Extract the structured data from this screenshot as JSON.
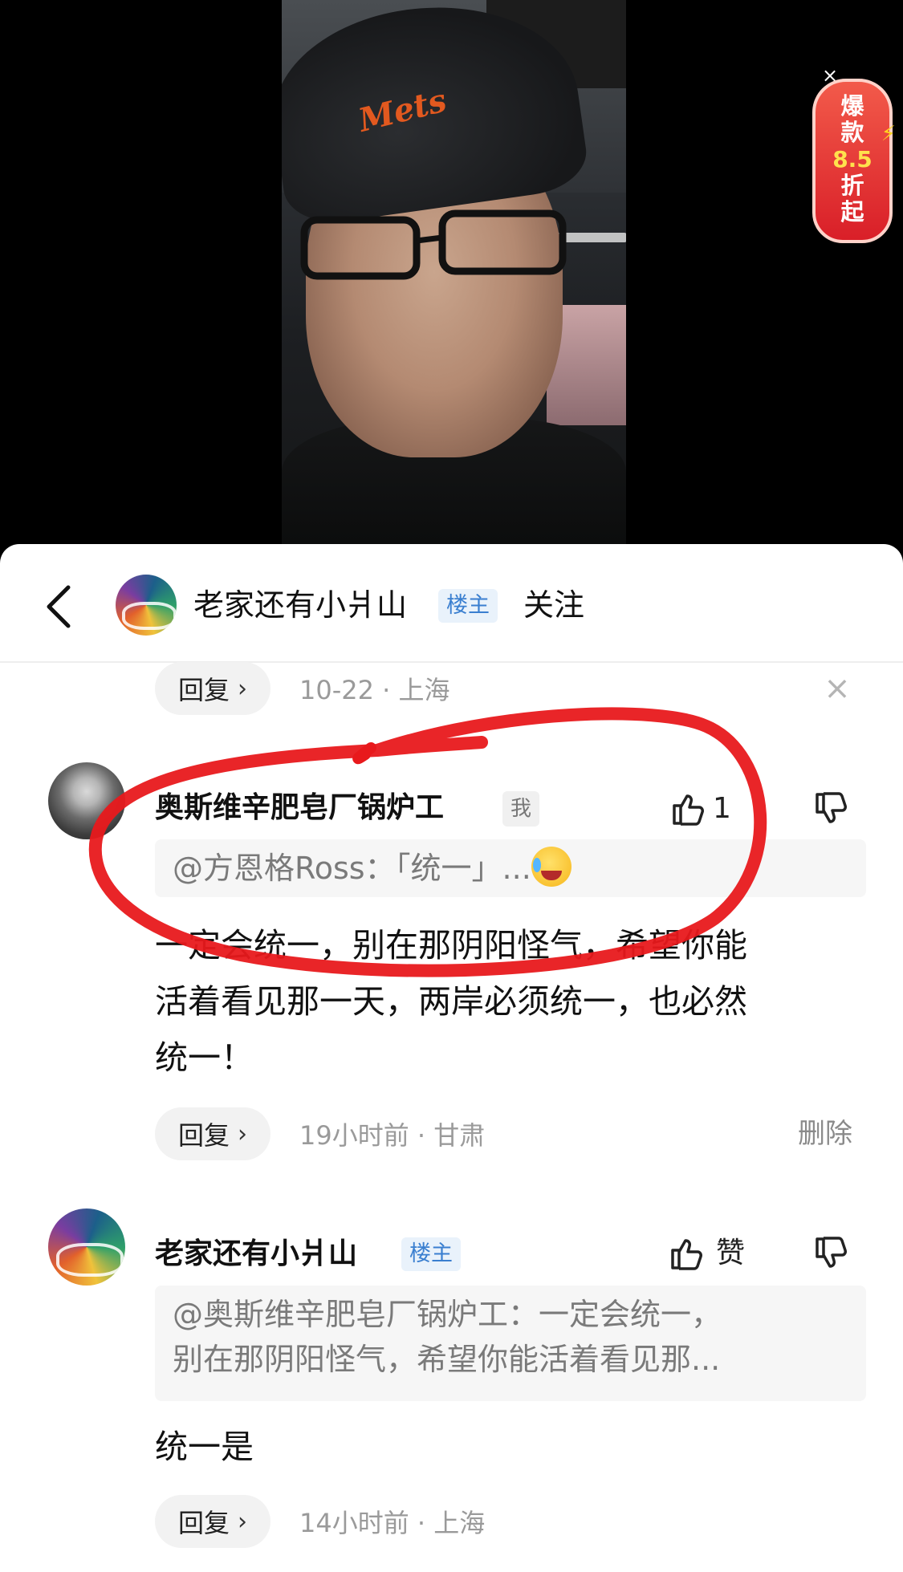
{
  "promo": {
    "line1": "爆",
    "line2": "款",
    "discount": "8.5",
    "line4": "折",
    "line5": "起",
    "close_symbol": "×"
  },
  "header": {
    "username": "老家还有小爿山",
    "owner_tag": "楼主",
    "follow_label": "关注"
  },
  "prev_comment_meta": {
    "reply_label": "回复",
    "date_location": "10-22 · 上海",
    "close_symbol": "×"
  },
  "comments": [
    {
      "author": "奥斯维辛肥皂厂锅炉工",
      "me_tag": "我",
      "quote": "@方恩格Ross：「统一」...",
      "body_line1": "一定会统一，别在那阴阳怪气，希望你能",
      "body_line2": "活着看见那一天，两岸必须统一，也必然",
      "body_line3": "统一！",
      "like_count": "1",
      "reply_label": "回复",
      "time_location": "19小时前 · 甘肃",
      "delete_label": "删除"
    },
    {
      "author": "老家还有小爿山",
      "owner_tag": "楼主",
      "like_label": "赞",
      "quote_line1": "@奥斯维辛肥皂厂锅炉工：一定会统一，",
      "quote_line2": "别在那阴阳怪气，希望你能活着看见那...",
      "body": "统一是",
      "reply_label": "回复",
      "time_location": "14小时前 · 上海"
    }
  ],
  "colors": {
    "annotation_red": "#e8191c",
    "tag_blue": "#3a7fd0",
    "promo_red": "#d91f28"
  }
}
